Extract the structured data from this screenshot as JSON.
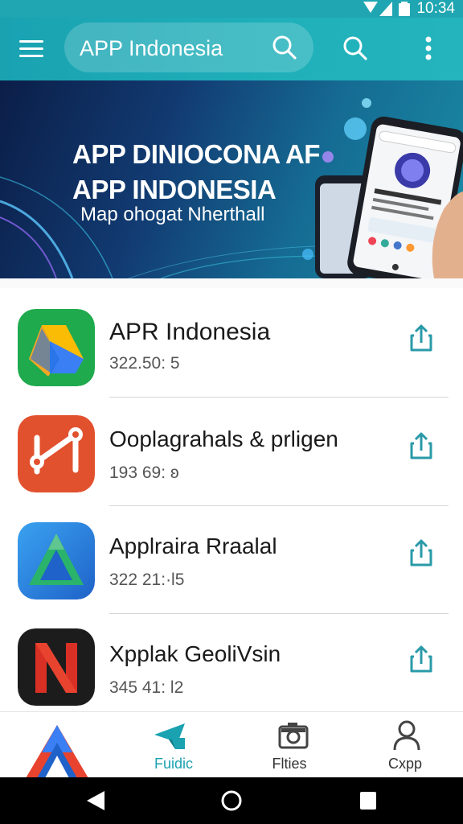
{
  "status_bar": {
    "time": "10:34"
  },
  "app_bar": {
    "search_text": "APP Indonesia",
    "icons": [
      "menu-icon",
      "search-icon",
      "search-icon",
      "more-vert-icon"
    ]
  },
  "banner": {
    "title_line1": "APP DINIOCONA AF",
    "title_line2": "APP INDONESIA",
    "subtitle": "Map ohogat Nherthall"
  },
  "apps": [
    {
      "name": "APR Indonesia",
      "meta": "322.50: 5",
      "icon": "drive-triangle-icon",
      "action_icon": "share-icon"
    },
    {
      "name": "Ooplagrahals & prligen",
      "meta": "193 69: ʚ",
      "icon": "graph-link-icon",
      "action_icon": "share-icon"
    },
    {
      "name": "Applraira Rraalal",
      "meta": "322 21:·l5",
      "icon": "a-triangle-icon",
      "action_icon": "share-icon"
    },
    {
      "name": "Xpplak GeoliVsin",
      "meta": "345 41: l2",
      "icon": "n-letter-icon",
      "action_icon": "share-icon"
    }
  ],
  "bottom_nav": [
    {
      "label": "",
      "icon": "brand-logo-icon"
    },
    {
      "label": "Fuidic",
      "icon": "paper-plane-icon",
      "active": true
    },
    {
      "label": "Flties",
      "icon": "camera-icon"
    },
    {
      "label": "Cxpp",
      "icon": "person-icon"
    }
  ],
  "colors": {
    "primary": "#1aa2b1",
    "accent_teal": "#2a9aa8",
    "banner_dark": "#0b1e48"
  }
}
